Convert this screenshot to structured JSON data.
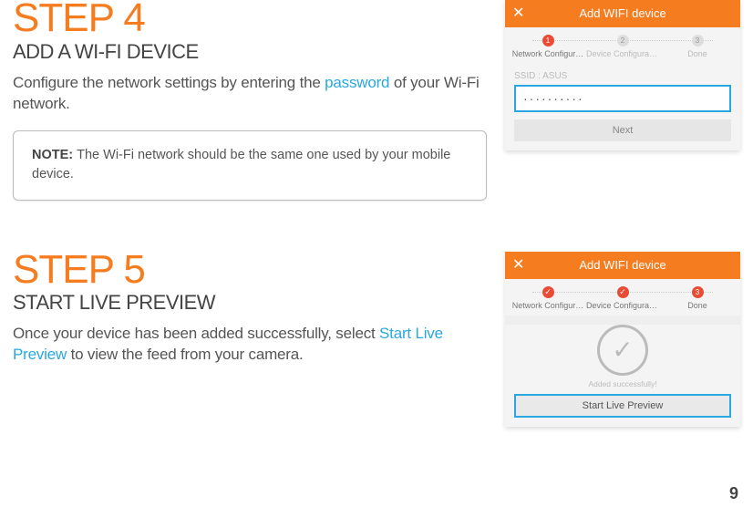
{
  "page_number": "9",
  "step4": {
    "heading": "STEP 4",
    "subtitle": "ADD A WI-FI DEVICE",
    "body_pre": "Configure the network settings by entering the ",
    "keyword": "password",
    "body_post": " of your Wi-Fi network.",
    "note_label": "NOTE: ",
    "note_body": "The Wi-Fi network should be the same one used by your mobile device."
  },
  "step5": {
    "heading": "STEP 5",
    "subtitle": "START LIVE PREVIEW",
    "body_pre": "Once your device has been added successfully, select ",
    "keyword": "Start Live Preview",
    "body_post": " to view the feed from your camera."
  },
  "phone1": {
    "title": "Add WIFI device",
    "close": "✕",
    "steps": [
      {
        "num": "1",
        "label": "Network Configur…",
        "active": true
      },
      {
        "num": "2",
        "label": "Device Configurati…",
        "active": false
      },
      {
        "num": "3",
        "label": "Done",
        "active": false
      }
    ],
    "ssid_label": "SSID : ",
    "ssid_value": "ASUS",
    "password_masked": "··········",
    "next_label": "Next"
  },
  "phone2": {
    "title": "Add WIFI device",
    "close": "✕",
    "steps": [
      {
        "label": "Network Configur…",
        "check": true
      },
      {
        "label": "Device Configurati…",
        "check": true
      },
      {
        "num": "3",
        "label": "Done",
        "active": true
      }
    ],
    "added_msg": "Added successfully!",
    "preview_label": "Start Live Preview"
  }
}
